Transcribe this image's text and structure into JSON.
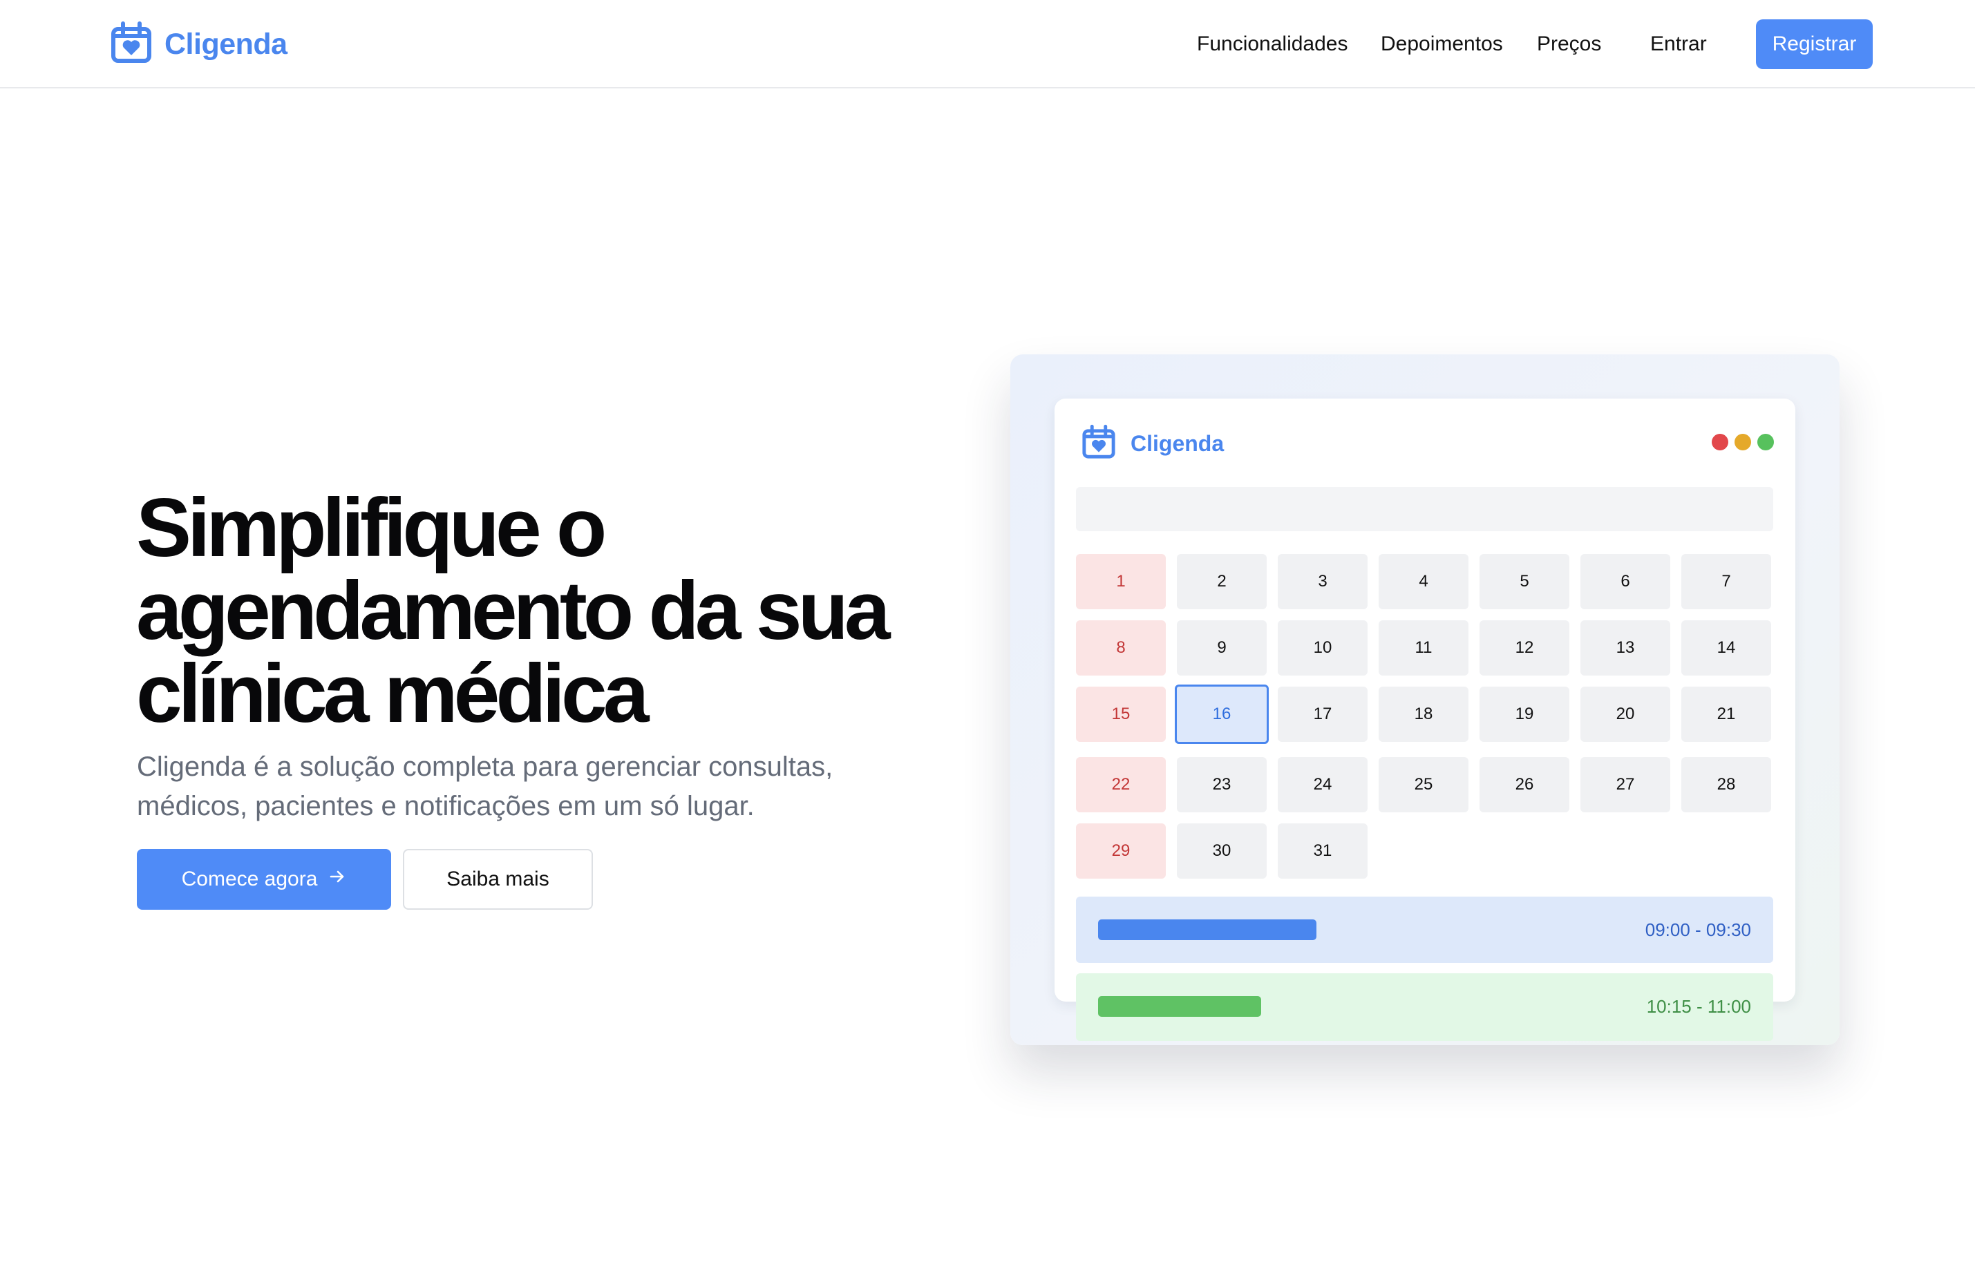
{
  "nav": {
    "brand": "Cligenda",
    "links": [
      "Funcionalidades",
      "Depoimentos",
      "Preços",
      "Entrar"
    ],
    "register_label": "Registrar"
  },
  "hero": {
    "title": "Simplifique o agendamento da sua clínica médica",
    "subtitle": "Cligenda é a solução completa para gerenciar consultas, médicos, pacientes e notificações em um só lugar.",
    "primary_cta": "Comece agora",
    "secondary_cta": "Saiba mais"
  },
  "preview": {
    "brand": "Cligenda",
    "window_dots": [
      "#e2474b",
      "#e5a92a",
      "#57c15d"
    ],
    "calendar": {
      "days": [
        {
          "label": "1",
          "type": "weekend"
        },
        {
          "label": "2"
        },
        {
          "label": "3"
        },
        {
          "label": "4"
        },
        {
          "label": "5"
        },
        {
          "label": "6"
        },
        {
          "label": "7"
        },
        {
          "label": "8",
          "type": "weekend"
        },
        {
          "label": "9"
        },
        {
          "label": "10"
        },
        {
          "label": "11"
        },
        {
          "label": "12"
        },
        {
          "label": "13"
        },
        {
          "label": "14"
        },
        {
          "label": "15",
          "type": "weekend"
        },
        {
          "label": "16",
          "type": "selected"
        },
        {
          "label": "17"
        },
        {
          "label": "18"
        },
        {
          "label": "19"
        },
        {
          "label": "20"
        },
        {
          "label": "21"
        },
        {
          "label": "22",
          "type": "weekend"
        },
        {
          "label": "23"
        },
        {
          "label": "24"
        },
        {
          "label": "25"
        },
        {
          "label": "26"
        },
        {
          "label": "27"
        },
        {
          "label": "28"
        },
        {
          "label": "29",
          "type": "weekend"
        },
        {
          "label": "30"
        },
        {
          "label": "31"
        }
      ]
    },
    "appointments": [
      {
        "time": "09:00 - 09:30",
        "color": "#4a86ee",
        "bg": "#dde8fa",
        "text_color": "#2f5fc4"
      },
      {
        "time": "10:15 - 11:00",
        "color": "#5fc264",
        "bg": "#e2f8e6",
        "text_color": "#3f8f46"
      }
    ]
  },
  "colors": {
    "accent": "#4f8bf7"
  }
}
